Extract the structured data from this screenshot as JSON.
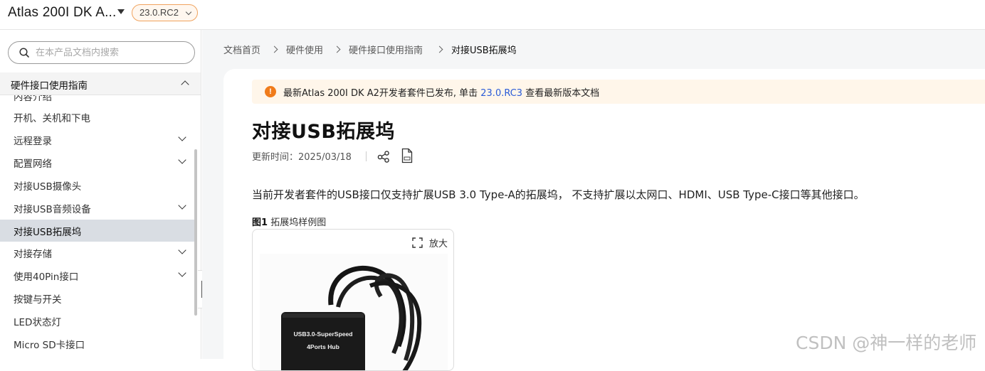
{
  "header": {
    "product_title": "Atlas 200I DK A...",
    "version": "23.0.RC2"
  },
  "sidebar": {
    "search_placeholder": "在本产品文档内搜索",
    "section_title": "硬件接口使用指南",
    "partial_item": "内容介绍",
    "items": [
      {
        "label": "开机、关机和下电",
        "expandable": false,
        "active": false
      },
      {
        "label": "远程登录",
        "expandable": true,
        "active": false
      },
      {
        "label": "配置网络",
        "expandable": true,
        "active": false
      },
      {
        "label": "对接USB摄像头",
        "expandable": false,
        "active": false
      },
      {
        "label": "对接USB音频设备",
        "expandable": true,
        "active": false
      },
      {
        "label": "对接USB拓展坞",
        "expandable": false,
        "active": true
      },
      {
        "label": "对接存储",
        "expandable": true,
        "active": false
      },
      {
        "label": "使用40Pin接口",
        "expandable": true,
        "active": false
      },
      {
        "label": "按键与开关",
        "expandable": false,
        "active": false
      },
      {
        "label": "LED状态灯",
        "expandable": false,
        "active": false
      },
      {
        "label": "Micro SD卡接口",
        "expandable": false,
        "active": false
      }
    ]
  },
  "breadcrumb": [
    "文档首页",
    "硬件使用",
    "硬件接口使用指南",
    "对接USB拓展坞"
  ],
  "notice": {
    "icon": "!",
    "prefix": "最新Atlas 200I DK A2开发者套件已发布, 单击 ",
    "link": "23.0.RC3",
    "suffix": " 查看最新版本文档"
  },
  "article": {
    "title": "对接USB拓展坞",
    "updated": "更新时间：2025/03/18",
    "body": "当前开发者套件的USB接口仅支持扩展USB 3.0 Type-A的拓展坞， 不支持扩展以太网口、HDMI、USB Type-C接口等其他接口。",
    "figure_label": "图1",
    "figure_caption": "拓展坞样例图",
    "zoom_label": "放大",
    "hub_text_line1": "USB3.0-SuperSpeed",
    "hub_text_line2": "4Ports Hub"
  },
  "watermark": "CSDN @神一样的老师",
  "colors": {
    "accent_orange": "#f07b1a",
    "link_blue": "#2a5bd7",
    "active_nav_bg": "#d9dde3",
    "notice_bg": "#fff6ea"
  }
}
